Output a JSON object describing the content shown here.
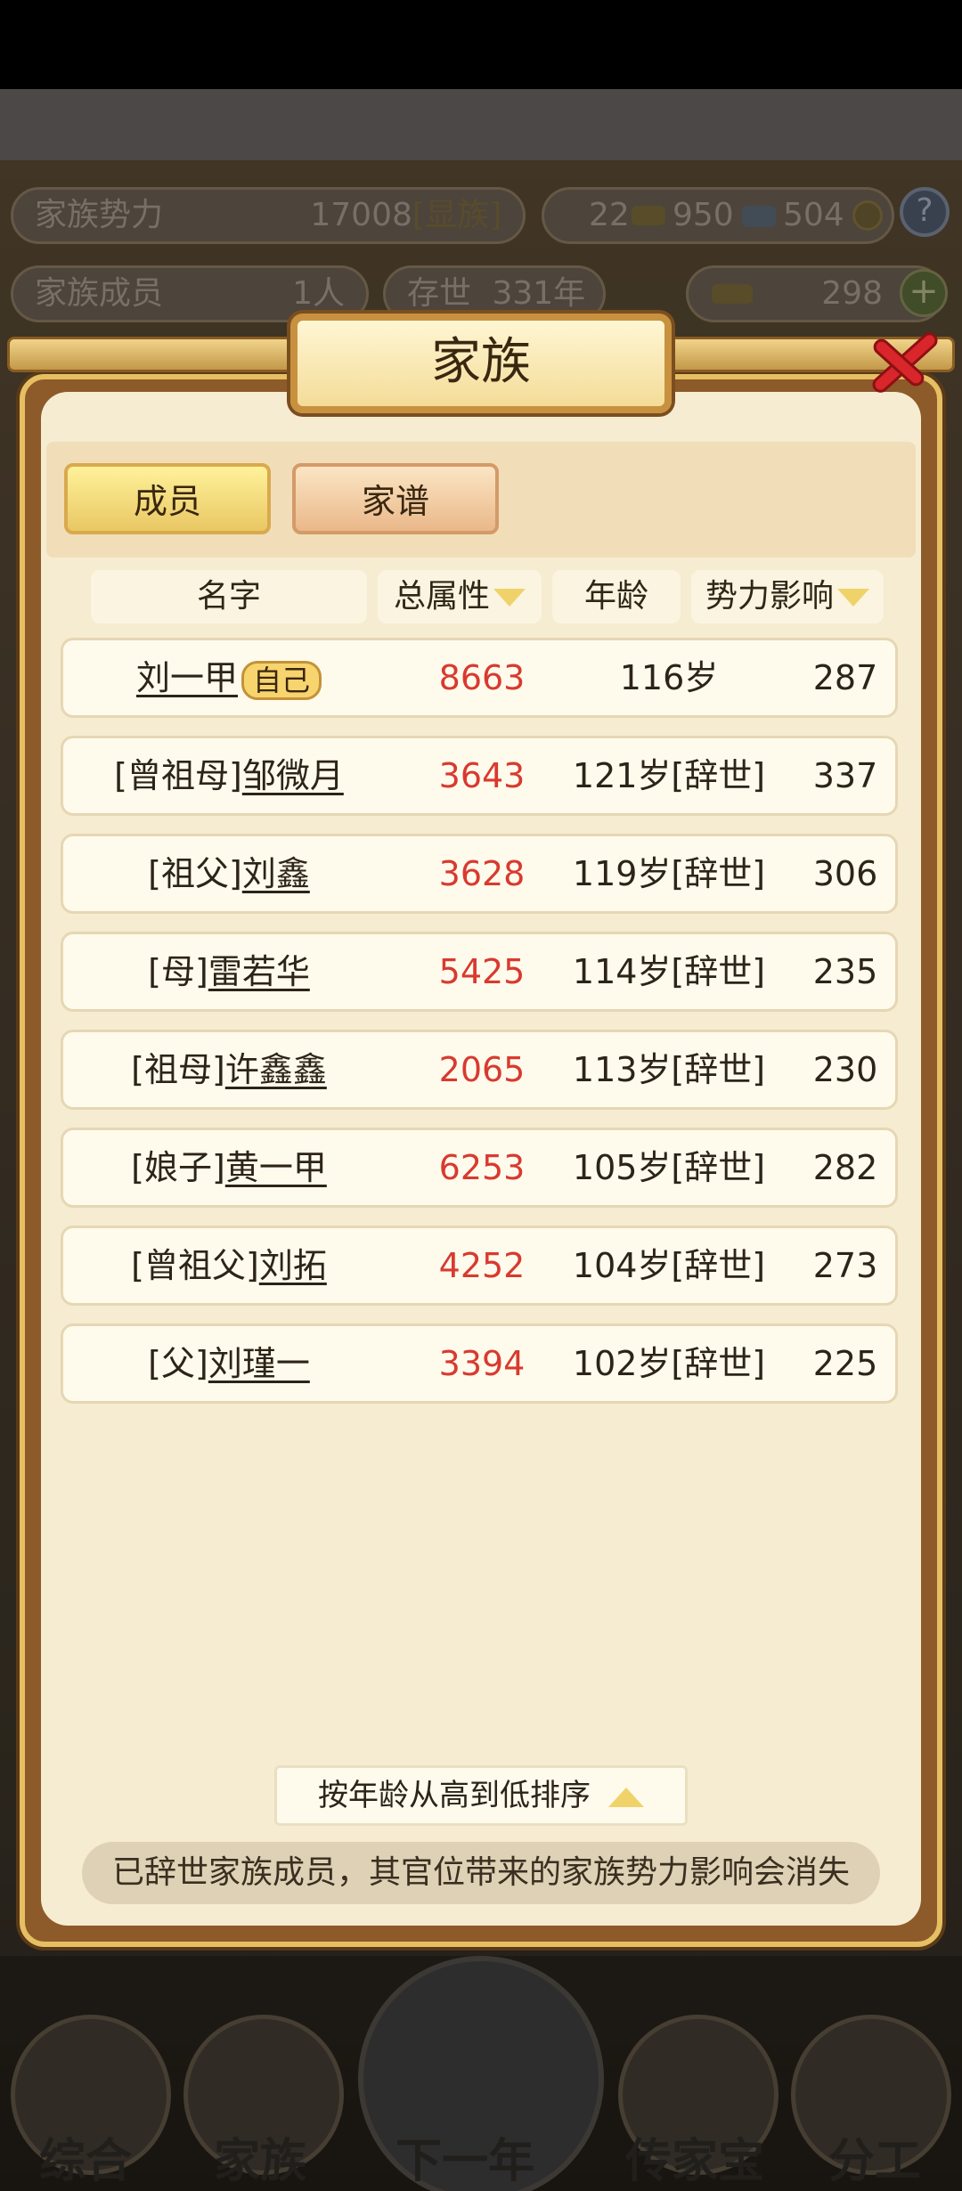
{
  "top": {
    "power_label": "家族势力",
    "power_value": "17008",
    "power_tag": "[显族]",
    "members_label": "家族成员",
    "members_value": "1人",
    "exist_label": "存世",
    "exist_value": "331年",
    "res1": "22",
    "res2": "950",
    "res3": "504",
    "currency": "298",
    "help_icon": "?"
  },
  "dialog": {
    "title": "家族",
    "tabs": [
      "成员",
      "家谱"
    ],
    "columns": [
      "名字",
      "总属性",
      "年龄",
      "势力影响"
    ],
    "rows": [
      {
        "prefix": "",
        "name": "刘一甲",
        "badge": "自己",
        "attr": "8663",
        "age": "116岁",
        "inf": "287"
      },
      {
        "prefix": "[曾祖母]",
        "name": "邹微月",
        "badge": "",
        "attr": "3643",
        "age": "121岁[辞世]",
        "inf": "337"
      },
      {
        "prefix": "[祖父]",
        "name": "刘鑫",
        "badge": "",
        "attr": "3628",
        "age": "119岁[辞世]",
        "inf": "306"
      },
      {
        "prefix": "[母]",
        "name": "雷若华",
        "badge": "",
        "attr": "5425",
        "age": "114岁[辞世]",
        "inf": "235"
      },
      {
        "prefix": "[祖母]",
        "name": "许鑫鑫",
        "badge": "",
        "attr": "2065",
        "age": "113岁[辞世]",
        "inf": "230"
      },
      {
        "prefix": "[娘子]",
        "name": "黄一甲",
        "badge": "",
        "attr": "6253",
        "age": "105岁[辞世]",
        "inf": "282"
      },
      {
        "prefix": "[曾祖父]",
        "name": "刘拓",
        "badge": "",
        "attr": "4252",
        "age": "104岁[辞世]",
        "inf": "273"
      },
      {
        "prefix": "[父]",
        "name": "刘瑾一",
        "badge": "",
        "attr": "3394",
        "age": "102岁[辞世]",
        "inf": "225"
      }
    ],
    "sort_label": "按年龄从高到低排序",
    "notice": "已辞世家族成员，其官位带来的家族势力影响会消失"
  },
  "nav": [
    "综合",
    "家族",
    "下一年",
    "传家宝",
    "分工"
  ],
  "colors": {
    "attr_red": "#d83a30",
    "accent_gold": "#e7bf63"
  }
}
